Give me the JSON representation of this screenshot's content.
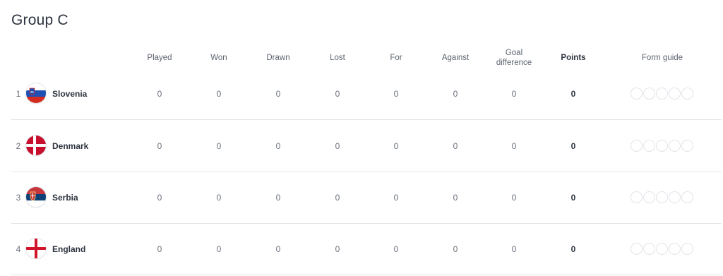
{
  "group": {
    "title": "Group C"
  },
  "columns": {
    "played": "Played",
    "won": "Won",
    "drawn": "Drawn",
    "lost": "Lost",
    "for": "For",
    "against": "Against",
    "goal_difference": "Goal difference",
    "points": "Points",
    "form_guide": "Form guide"
  },
  "rows": [
    {
      "position": "1",
      "team": "Slovenia",
      "flag_icon": "slovenia-flag-icon",
      "played": "0",
      "won": "0",
      "drawn": "0",
      "lost": "0",
      "for": "0",
      "against": "0",
      "goal_difference": "0",
      "points": "0"
    },
    {
      "position": "2",
      "team": "Denmark",
      "flag_icon": "denmark-flag-icon",
      "played": "0",
      "won": "0",
      "drawn": "0",
      "lost": "0",
      "for": "0",
      "against": "0",
      "goal_difference": "0",
      "points": "0"
    },
    {
      "position": "3",
      "team": "Serbia",
      "flag_icon": "serbia-flag-icon",
      "played": "0",
      "won": "0",
      "drawn": "0",
      "lost": "0",
      "for": "0",
      "against": "0",
      "goal_difference": "0",
      "points": "0"
    },
    {
      "position": "4",
      "team": "England",
      "flag_icon": "england-flag-icon",
      "played": "0",
      "won": "0",
      "drawn": "0",
      "lost": "0",
      "for": "0",
      "against": "0",
      "goal_difference": "0",
      "points": "0"
    }
  ],
  "colors": {
    "slovenia": [
      "#ffffff",
      "#1f4fb3",
      "#d52b1e"
    ],
    "denmark": [
      "#c8102e",
      "#ffffff"
    ],
    "serbia": [
      "#c6363c",
      "#0c4076",
      "#ffffff"
    ],
    "england": [
      "#ffffff",
      "#cf142b"
    ]
  }
}
